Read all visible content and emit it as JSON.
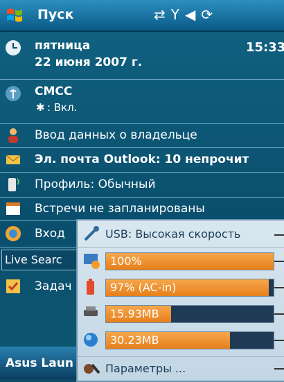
{
  "title_bar": {
    "start_label": "Пуск"
  },
  "today": {
    "date_weekday": "пятница",
    "date_full": "22 июня 2007 г.",
    "time": "15:33",
    "carrier": "CMCC",
    "bluetooth_status": ": Вкл.",
    "owner_info": "Ввод данных о владельце",
    "email": "Эл. почта Outlook: 10 непрочит",
    "profile": "Профиль: Обычный",
    "appointments": "Встречи не запланированы",
    "inbox_partial": "Вход",
    "live_search_partial": "Live Searc",
    "tasks_partial": "Задач"
  },
  "bottom_bar": {
    "asus_label": "Asus Laun"
  },
  "popup": {
    "usb_label": "USB: Высокая скорость",
    "brightness": {
      "label": "100%",
      "fill": 1.0
    },
    "battery": {
      "label": "97% (AC-in)",
      "fill": 0.97
    },
    "storage": {
      "label": "15.93MB",
      "fill": 0.39
    },
    "memory": {
      "label": "30.23MB",
      "fill": 0.74
    },
    "settings_label": "Параметры ..."
  },
  "colors": {
    "accent": "#e6801c",
    "background": "#0d4a66",
    "popup": "#d9e7f0"
  }
}
